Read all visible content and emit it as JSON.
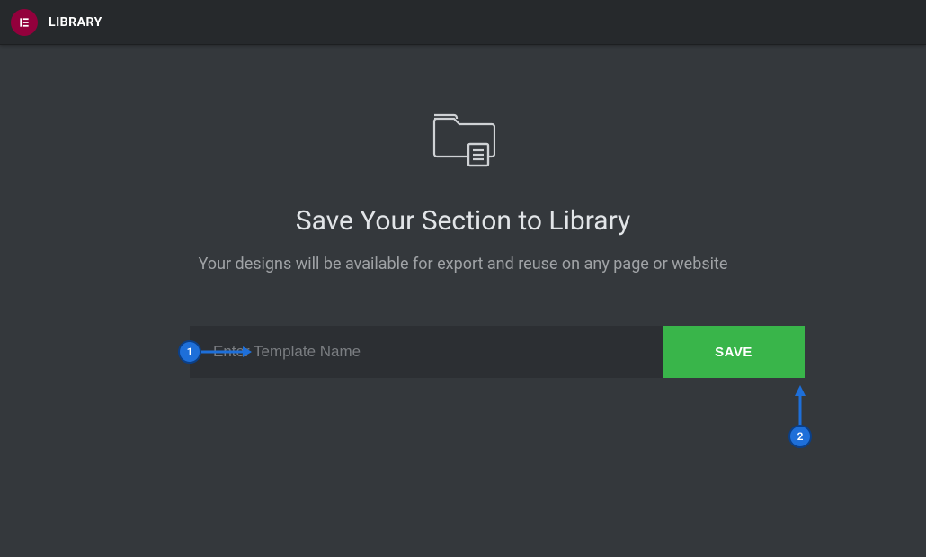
{
  "topbar": {
    "title": "LIBRARY"
  },
  "main": {
    "heading": "Save Your Section to Library",
    "subheading": "Your designs will be available for export and reuse on any page or website",
    "input_placeholder": "Enter Template Name",
    "input_value": "",
    "save_label": "SAVE"
  },
  "annotations": {
    "callout1": "1",
    "callout2": "2"
  },
  "colors": {
    "accent": "#39b54a",
    "brand": "#93003c",
    "callout": "#1e6fd9"
  }
}
